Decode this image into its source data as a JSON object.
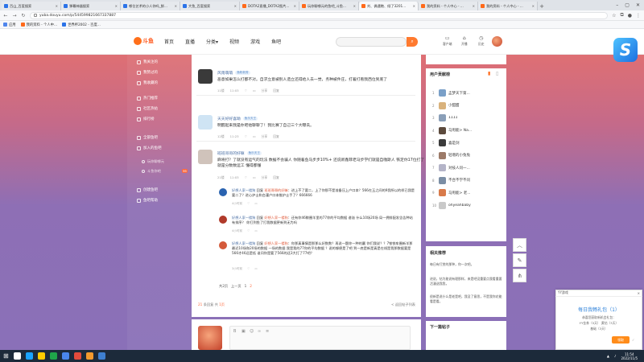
{
  "browser": {
    "tabs": [
      {
        "label": "百山_百度搜索",
        "color": "#2b73e8",
        "active": false
      },
      {
        "label": "弹幕神器搜索",
        "color": "#2b73e8",
        "active": false
      },
      {
        "label": "哪位艺术的小人你吗_鲜...",
        "color": "#2b73e8",
        "active": false
      },
      {
        "label": "大鱼_百度搜索",
        "color": "#2b73e8",
        "active": false
      },
      {
        "label": "DOTA2直播_DOTA2图片...",
        "color": "#ff6a1a",
        "active": false
      },
      {
        "label": "玩你聊哪元的鱼吧_斗鱼...",
        "color": "#ff6a1a",
        "active": false
      },
      {
        "label": "刘、偶遇鲍、倾了3201...",
        "color": "#ff6a1a",
        "active": true
      },
      {
        "label": "我的资料 - 个人中心 - ...",
        "color": "#ff6a1a",
        "active": false
      },
      {
        "label": "我的资料 - 个人中心 - ...",
        "color": "#ff6a1a",
        "active": false
      }
    ],
    "new_tab": "+",
    "url": "yuba.douyu.com/p/544599821667337887",
    "bookmarks": [
      {
        "label": "应用",
        "color": "#4f86ec"
      },
      {
        "label": "我的资料 - 个人中...",
        "color": "#ff6a1a"
      },
      {
        "label": "世界杯2002 - 百度...",
        "color": "#2b73e8"
      }
    ]
  },
  "site": {
    "logo_text": "斗鱼",
    "nav": [
      "首页",
      "直播",
      "分类▾",
      "视频",
      "游戏",
      "鱼吧"
    ],
    "header_icons": [
      {
        "label": "客户端",
        "glyph": "▭",
        "icon": "client-icon"
      },
      {
        "label": "开播",
        "glyph": "⌂",
        "icon": "broadcast-icon"
      },
      {
        "label": "历史",
        "glyph": "◷",
        "icon": "history-icon"
      },
      {
        "label": "我的个人",
        "glyph": "♡",
        "icon": "follow-icon"
      }
    ]
  },
  "sidebar": {
    "items": [
      {
        "label": "我关注的",
        "icon": "star-icon"
      },
      {
        "label": "我赞过的",
        "icon": "heart-icon"
      },
      {
        "label": "我收藏的",
        "icon": "bookmark-icon"
      },
      {
        "label": "热门推荐",
        "icon": "fire-icon"
      },
      {
        "label": "社区热帖",
        "icon": "post-icon"
      },
      {
        "label": "排行榜",
        "icon": "rank-icon"
      },
      {
        "label": "全部鱼吧",
        "icon": "grid-icon"
      },
      {
        "label": "加入的鱼吧",
        "icon": "join-icon"
      }
    ],
    "sub_items": [
      "玩你聊哪元",
      "斗鱼你吧"
    ],
    "bottom_items": [
      "创建鱼吧",
      "鱼吧帮助"
    ],
    "badge": "99"
  },
  "posts": [
    {
      "user": "风雨萌萌",
      "tag": "鱼粉新秀",
      "text": "恶意如果怎么打都不对。自求立意被别人造立还得给人去一觉，务种被件庄，打着打看我西位到底了",
      "time": "11楼",
      "date": "11:03",
      "actions": [
        "分享",
        "回复"
      ]
    },
    {
      "user": "天天好好喜呦",
      "tag": "鱼乐天王",
      "text": "明醒起来我是你吧他聊聊了！我比赛了自己三个大曝氏。",
      "time": "12楼",
      "date": "11:23",
      "actions": [
        "分享",
        "回复"
      ]
    },
    {
      "user": "班班哥哥的好嘛",
      "tag": "鱼乐天王",
      "text": "麻将打？了就没有运气的玩法 数据不会骗人 你随着鱼马步步10%+ 还说新鑫菲老马步学们就是自嗷斯人 铁定你17位打了就是分数数运工 懂得都懂",
      "time": "21楼",
      "date": "11:03",
      "actions": [
        "分享",
        "回复"
      ]
    }
  ],
  "replies": [
    {
      "user": "好想人家一楼狗",
      "mention": "班班哥哥的好嘛",
      "text": "进上不了要二，上了你那不是准备压上户口本？566在玉之间的9我所以的样已我是要二了？进心护士和台灌户口本推护士手了？666666",
      "meta": "4小时前"
    },
    {
      "user": "好想人家一楼狗",
      "mention": "好想人家一楼狗",
      "text": "还有你46鲸圈羊里的77你的平均数据 谱溢 什么10场20场 局一拥排配发告告种站有排序？ 你打到鱼了打我数据更新到无为吗",
      "meta": "4小时前"
    },
    {
      "user": "好想人家一楼狗",
      "mention": "好想人家一楼狗",
      "text": "你那真事情是那那么好数数？再说一题你一种的赢 你们我说？？7铁铁车圈新羊那最近10场和20场的数据 一场的数据 我是我的77你的平均数据 ？说的够便是了吧 到一底是新是真是在线是我那数据要是566才46还是低 谁问你是要了566的还3大打了77吧？",
      "meta": "3小时前"
    }
  ],
  "pager": {
    "label": "共2页",
    "pages": [
      "上一页",
      "1",
      "2"
    ]
  },
  "footer": {
    "count": "21",
    "count_label": "条回复 共",
    "pages": "1页",
    "link": "< 返回帖子列表"
  },
  "right_panel": {
    "user_rank_title": "用户贡献榜",
    "ranks": [
      {
        "n": "1",
        "name": "孟梦天下第...",
        "color": "#7aa0c8"
      },
      {
        "n": "2",
        "name": "小甜甜",
        "color": "#d9b27c"
      },
      {
        "n": "3",
        "name": "1111",
        "color": "#8a9fb8"
      },
      {
        "n": "4",
        "name": "马甩能> Na...",
        "color": "#5c4a3d"
      },
      {
        "n": "5",
        "name": "喜是剑",
        "color": "#3b3b3b"
      },
      {
        "n": "6",
        "name": "轻增的小兔兔",
        "color": "#9c7a68"
      },
      {
        "n": "7",
        "name": "对技人问一...",
        "color": "#b4b4c8"
      },
      {
        "n": "8",
        "name": "不合不学不问",
        "color": "#7b8ea5"
      },
      {
        "n": "9",
        "name": "马甩能> 老...",
        "color": "#d87a4a"
      },
      {
        "n": "10",
        "name": "ohyeahbaby",
        "color": "#c9c9c9"
      }
    ],
    "related_title": "相关推荐",
    "related_items": [
      "每日有打赏的那种，你一次吧。",
      "进说，钻为能说有理那样，来是吧没重要点我看重要活漫送我我，",
      "很新是说什么是老是吧，我没了意思，不是我你花能看是看。"
    ],
    "next_title": "下一篇帖子"
  },
  "float_buttons": [
    {
      "glyph": "︿",
      "icon": "back-to-top-icon"
    },
    {
      "glyph": "✎",
      "icon": "edit-icon"
    },
    {
      "glyph": "⋔",
      "icon": "share-icon"
    }
  ],
  "notification": {
    "header": "YY游戏",
    "close": "×",
    "title": "每日我畅礼包（1）",
    "lines": [
      "恭喜您获取新机会礼包：",
      "YY金券（5天）   黄钻（3天）",
      "基础（3天）"
    ],
    "button": "领取",
    "check": "✓"
  },
  "taskbar": {
    "time": "11:54",
    "date": "2022/11/5",
    "icon_colors": [
      "#ffffff",
      "#19a3ff",
      "#ffcc00",
      "#1fa54a",
      "#4a86ec",
      "#e34b3c",
      "#f29a2e",
      "#3e7fd0"
    ]
  }
}
